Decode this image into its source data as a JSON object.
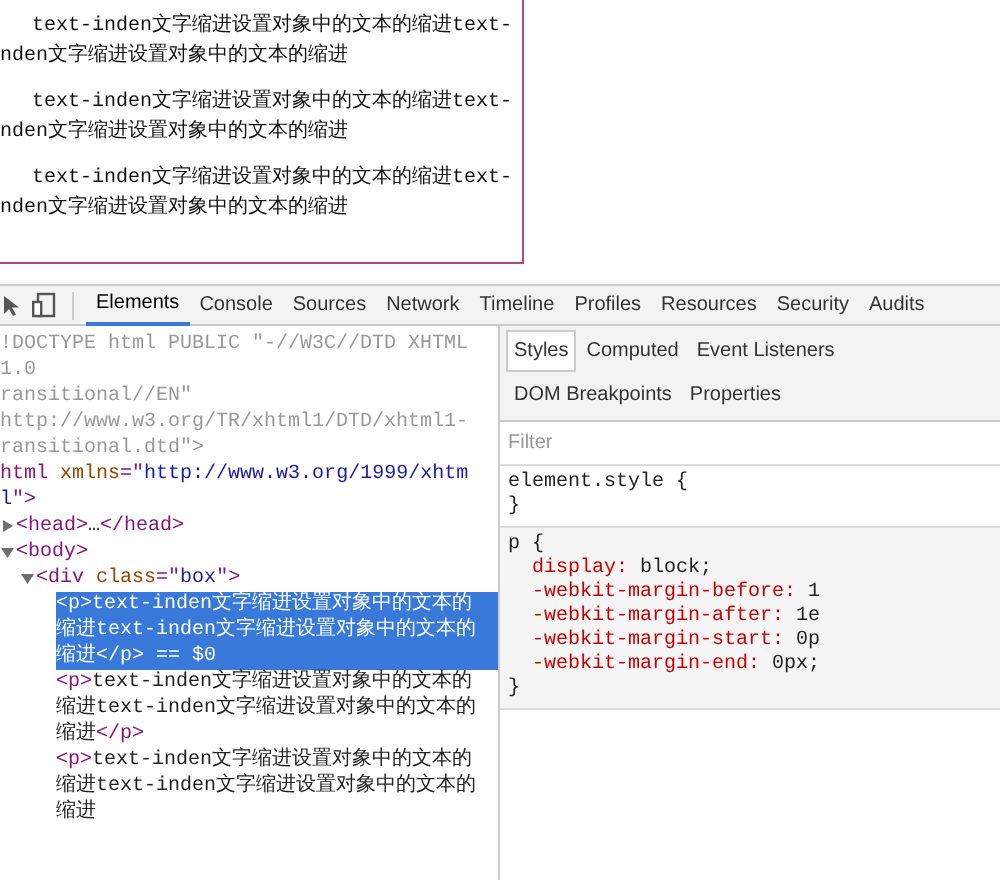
{
  "page": {
    "paragraphs": [
      {
        "lines": [
          "text-inden文字缩进设置对象中的文本的缩进text-",
          "nden文字缩进设置对象中的文本的缩进"
        ]
      },
      {
        "lines": [
          "text-inden文字缩进设置对象中的文本的缩进text-",
          "nden文字缩进设置对象中的文本的缩进"
        ]
      },
      {
        "lines": [
          "text-inden文字缩进设置对象中的文本的缩进text-",
          "nden文字缩进设置对象中的文本的缩进"
        ]
      }
    ]
  },
  "devtools": {
    "toolbar_tabs": [
      {
        "label": "Elements",
        "selected": true
      },
      {
        "label": "Console",
        "selected": false
      },
      {
        "label": "Sources",
        "selected": false
      },
      {
        "label": "Network",
        "selected": false
      },
      {
        "label": "Timeline",
        "selected": false
      },
      {
        "label": "Profiles",
        "selected": false
      },
      {
        "label": "Resources",
        "selected": false
      },
      {
        "label": "Security",
        "selected": false
      },
      {
        "label": "Audits",
        "selected": false
      }
    ],
    "dom_tree": [
      {
        "selected": false,
        "segments": [
          {
            "kind": "doctype",
            "text": "!DOCTYPE html PUBLIC \"-//W3C//DTD XHTML 1.0"
          }
        ]
      },
      {
        "selected": false,
        "segments": [
          {
            "kind": "doctype",
            "text": "ransitional//EN\""
          }
        ]
      },
      {
        "selected": false,
        "segments": [
          {
            "kind": "doctype",
            "text": "http://www.w3.org/TR/xhtml1/DTD/xhtml1-"
          }
        ]
      },
      {
        "selected": false,
        "segments": [
          {
            "kind": "doctype",
            "text": "ransitional.dtd\">"
          }
        ]
      },
      {
        "selected": false,
        "segments": [
          {
            "kind": "tag",
            "text": "html"
          },
          {
            "kind": "attr",
            "text": " xmlns"
          },
          {
            "kind": "tag",
            "text": "=\""
          },
          {
            "kind": "value",
            "text": "http://www.w3.org/1999/xhtml"
          },
          {
            "kind": "tag",
            "text": "\">"
          }
        ],
        "children": [
          {
            "expanded": false,
            "selected": false,
            "segments": [
              {
                "kind": "tag",
                "text": "<head>"
              },
              {
                "kind": "text",
                "text": "…"
              },
              {
                "kind": "tag",
                "text": "</head>"
              }
            ]
          },
          {
            "expanded": true,
            "selected": false,
            "segments": [
              {
                "kind": "tag",
                "text": "<body>"
              }
            ],
            "children": [
              {
                "expanded": true,
                "selected": false,
                "segments": [
                  {
                    "kind": "tag",
                    "text": "<div"
                  },
                  {
                    "kind": "attr",
                    "text": " class"
                  },
                  {
                    "kind": "tag",
                    "text": "=\""
                  },
                  {
                    "kind": "value",
                    "text": "box"
                  },
                  {
                    "kind": "tag",
                    "text": "\">"
                  }
                ],
                "children": [
                  {
                    "selected": true,
                    "segments": [
                      {
                        "kind": "tag",
                        "text": "<p>"
                      },
                      {
                        "kind": "text",
                        "text": "text-inden文字缩进设置对象中的文本的缩进text-inden文字缩进设置对象中的文本的缩进"
                      },
                      {
                        "kind": "tag",
                        "text": "</p>"
                      },
                      {
                        "kind": "marker",
                        "text": " == $0"
                      }
                    ]
                  },
                  {
                    "selected": false,
                    "segments": [
                      {
                        "kind": "tag",
                        "text": "<p>"
                      },
                      {
                        "kind": "text",
                        "text": "text-inden文字缩进设置对象中的文本的缩进text-inden文字缩进设置对象中的文本的缩进"
                      },
                      {
                        "kind": "tag",
                        "text": "</p>"
                      }
                    ]
                  },
                  {
                    "selected": false,
                    "segments": [
                      {
                        "kind": "tag",
                        "text": "<p>"
                      },
                      {
                        "kind": "text",
                        "text": "text-inden文字缩进设置对象中的文本的缩进text-inden文字缩进设置对象中的文本的缩进"
                      }
                    ]
                  }
                ]
              }
            ]
          }
        ]
      }
    ],
    "styles_tabs": [
      {
        "label": "Styles",
        "selected": true
      },
      {
        "label": "Computed",
        "selected": false
      },
      {
        "label": "Event Listeners",
        "selected": false
      },
      {
        "label": "DOM Breakpoints",
        "selected": false
      },
      {
        "label": "Properties",
        "selected": false
      }
    ],
    "filter": {
      "placeholder": "Filter"
    },
    "rules": [
      {
        "header": "element.style {",
        "footer": "}"
      },
      {
        "header": "p {",
        "declarations": [
          {
            "property": "display:",
            "value": "block;"
          },
          {
            "property": "-webkit-margin-before:",
            "value": "1"
          },
          {
            "property": "-webkit-margin-after:",
            "value": "1e"
          },
          {
            "property": "-webkit-margin-start:",
            "value": "0p"
          },
          {
            "property": "-webkit-margin-end:",
            "value": "0px;"
          }
        ],
        "footer": "}"
      }
    ]
  }
}
